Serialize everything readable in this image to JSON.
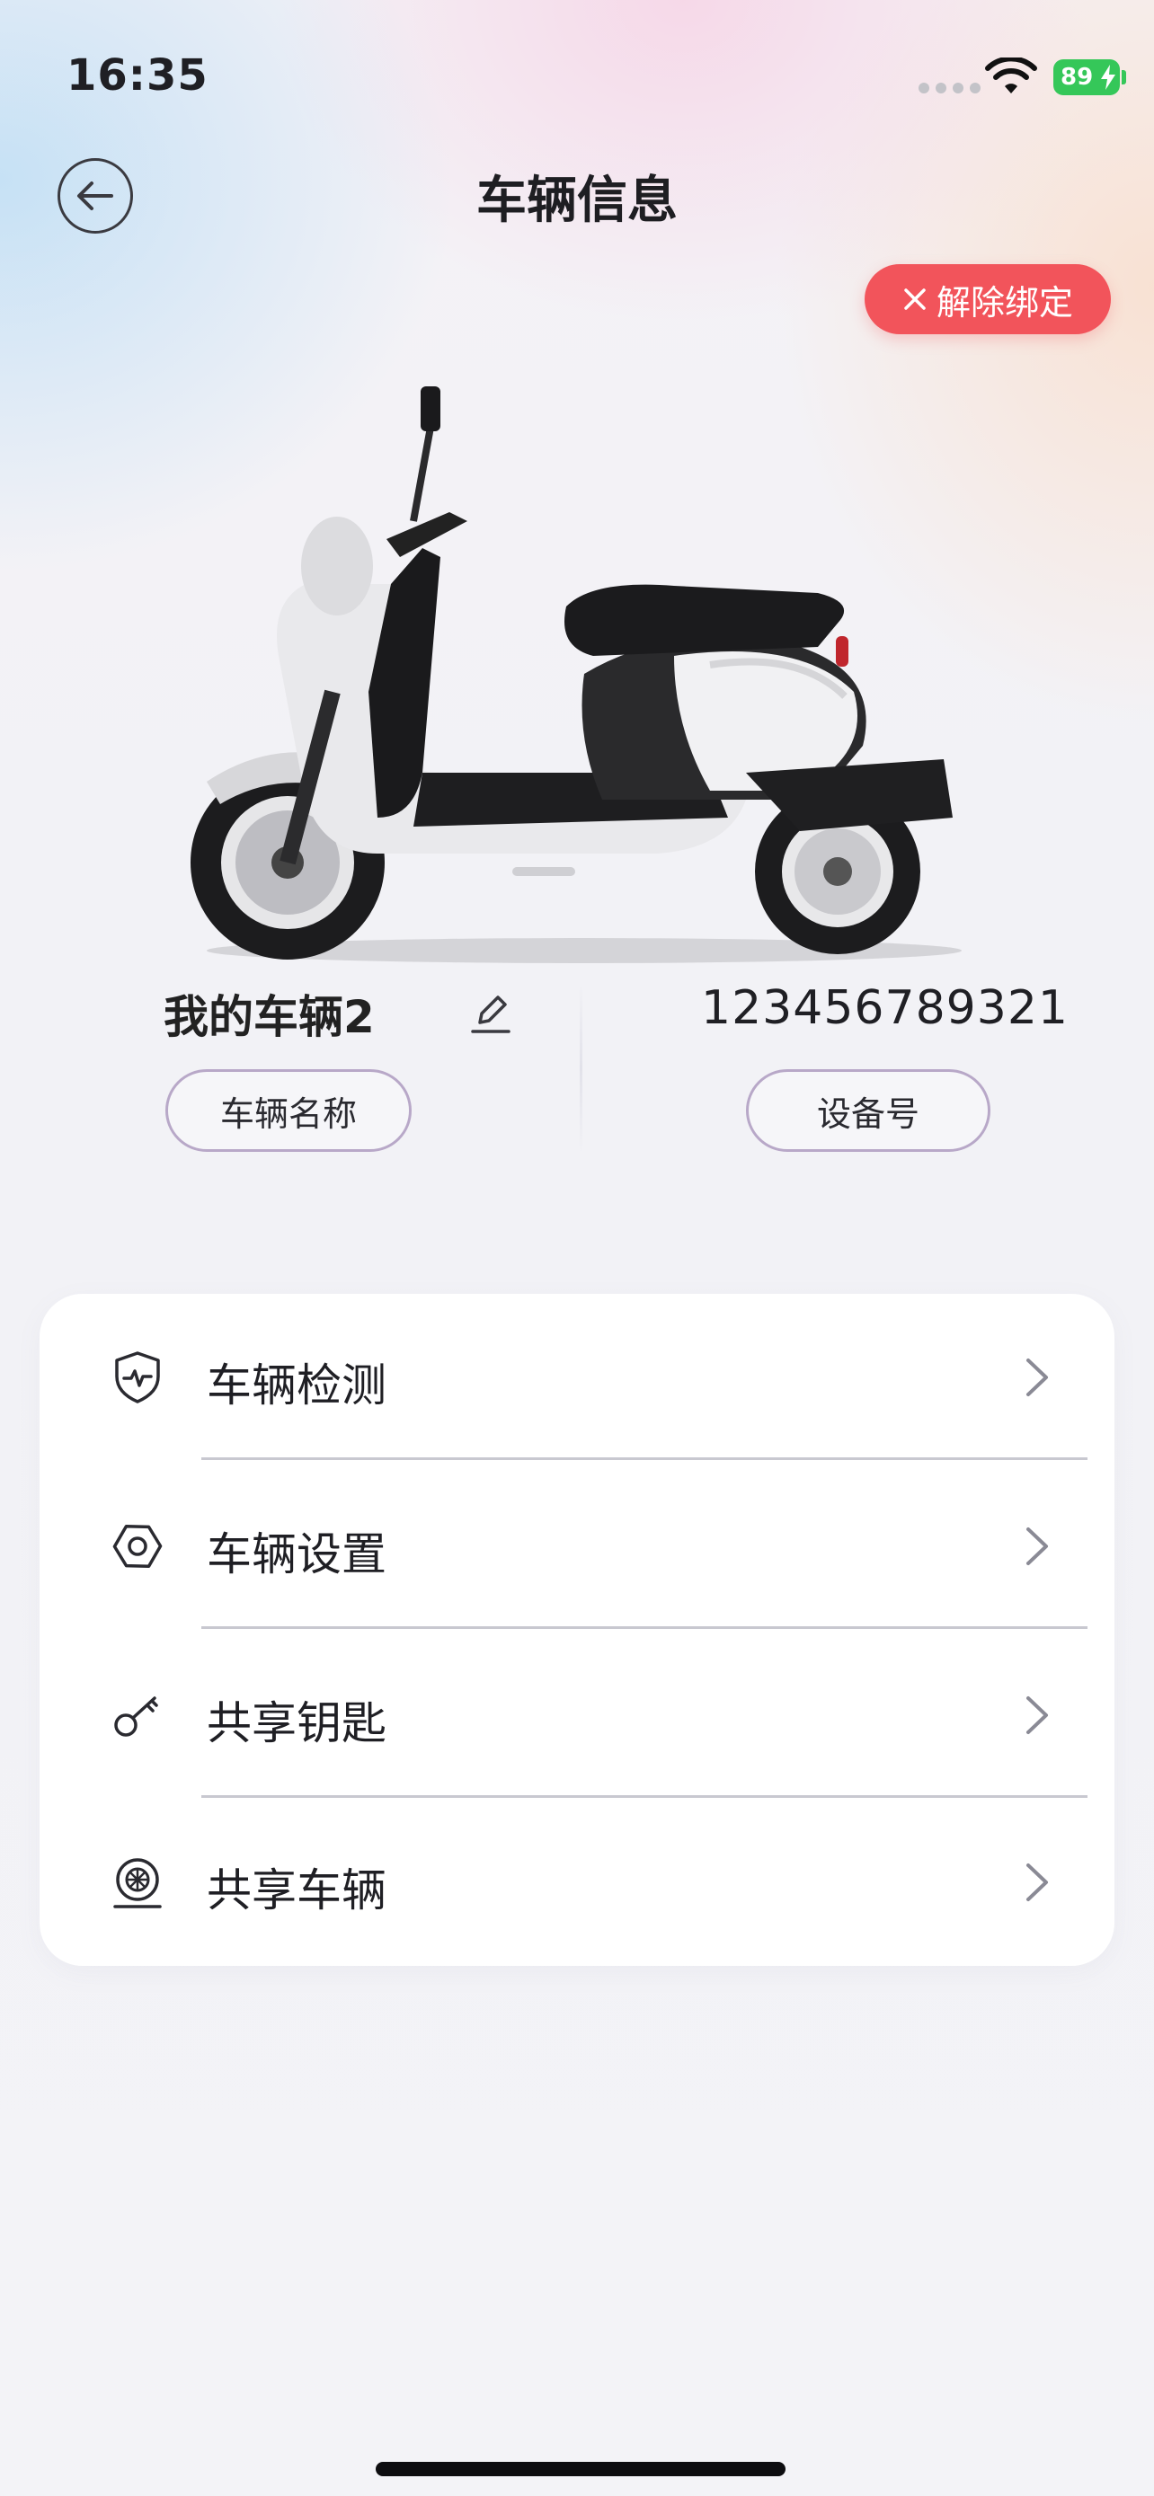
{
  "status_bar": {
    "time": "16:35",
    "battery": "89"
  },
  "nav": {
    "title": "车辆信息"
  },
  "unbind_button": {
    "label": "解除绑定"
  },
  "vehicle": {
    "name": "我的车辆2",
    "name_tag": "车辆名称",
    "device_number": "123456789321",
    "device_tag": "设备号"
  },
  "menu": {
    "items": [
      {
        "label": "车辆检测",
        "icon": "shield-pulse-icon"
      },
      {
        "label": "车辆设置",
        "icon": "hex-nut-icon"
      },
      {
        "label": "共享钥匙",
        "icon": "key-icon"
      },
      {
        "label": "共享车辆",
        "icon": "wheel-icon"
      }
    ]
  },
  "colors": {
    "accent_red": "#f2545b",
    "battery_green": "#35c759",
    "pill_border": "#b8a8c8"
  }
}
